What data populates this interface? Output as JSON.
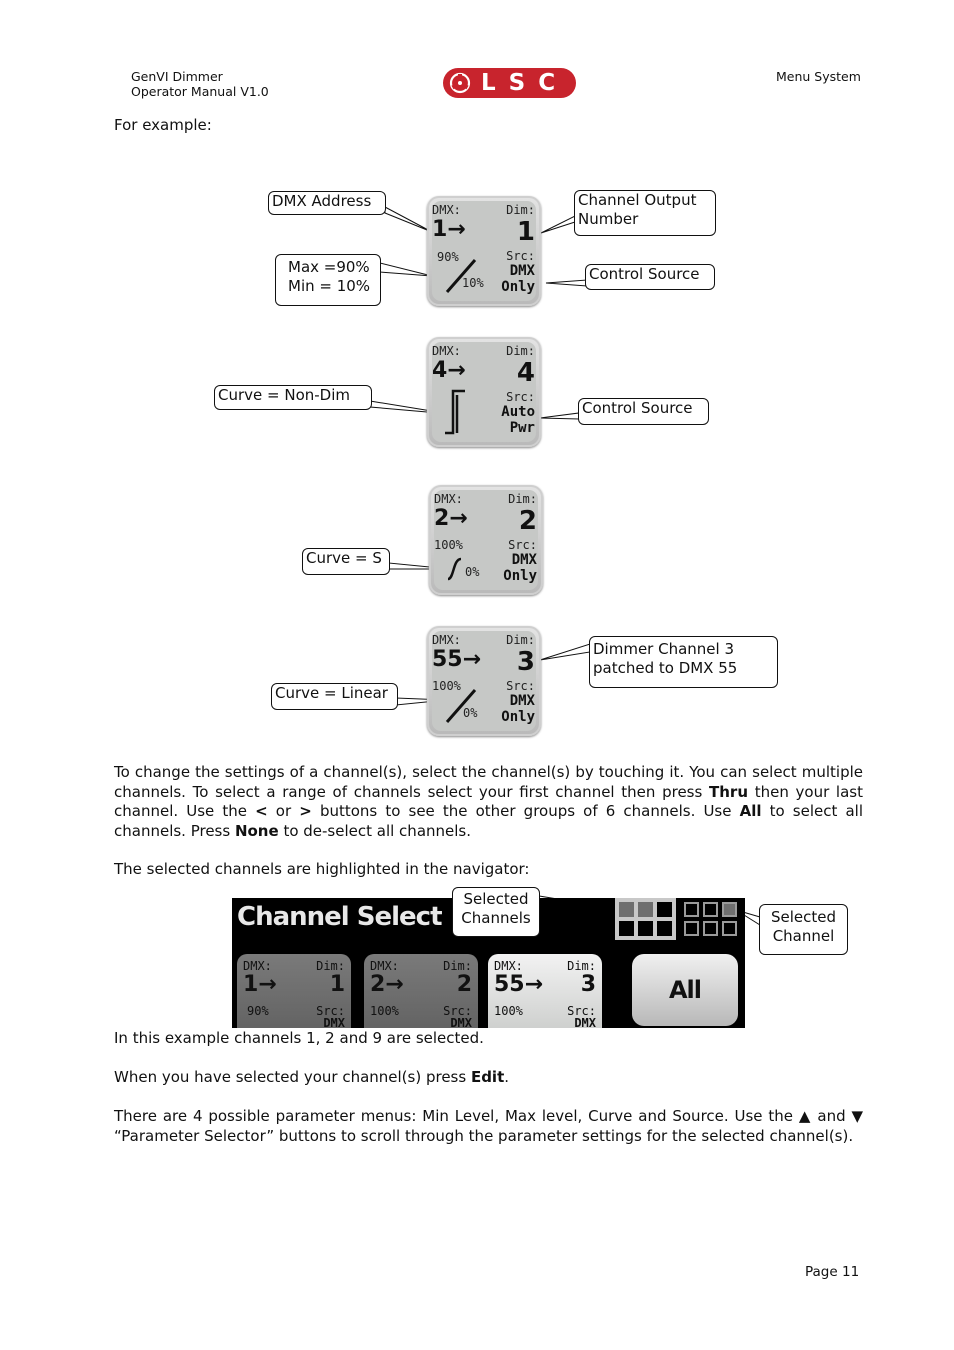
{
  "header": {
    "left_line1": "GenVI Dimmer",
    "left_line2": "Operator Manual V1.0",
    "logo_text": "LSC",
    "right": "Menu System"
  },
  "intro": "For example:",
  "tiles": [
    {
      "dmx_label": "DMX:",
      "dim_label": "Dim:",
      "dmx_value": "1→",
      "dim_value": "1",
      "max": "90%",
      "min": "10%",
      "curve": "linear",
      "src_label": "Src:",
      "src_line1": "DMX",
      "src_line2": "Only",
      "callouts": {
        "dmx": "DMX Address",
        "dim": "Channel Output Number",
        "range_line1": "Max =90%",
        "range_line2": "Min = 10%",
        "source": "Control Source"
      }
    },
    {
      "dmx_label": "DMX:",
      "dim_label": "Dim:",
      "dmx_value": "4→",
      "dim_value": "4",
      "curve": "non-dim",
      "src_label": "Src:",
      "src_line1": "Auto",
      "src_line2": "Pwr",
      "callouts": {
        "curve": "Curve = Non-Dim",
        "source": "Control Source"
      }
    },
    {
      "dmx_label": "DMX:",
      "dim_label": "Dim:",
      "dmx_value": "2→",
      "dim_value": "2",
      "max": "100%",
      "min": "0%",
      "curve": "s",
      "src_label": "Src:",
      "src_line1": "DMX",
      "src_line2": "Only",
      "callouts": {
        "curve": "Curve = S"
      }
    },
    {
      "dmx_label": "DMX:",
      "dim_label": "Dim:",
      "dmx_value": "55→",
      "dim_value": "3",
      "max": "100%",
      "min": "0%",
      "curve": "linear",
      "src_label": "Src:",
      "src_line1": "DMX",
      "src_line2": "Only",
      "callouts": {
        "curve": "Curve = Linear",
        "patch_line1": "Dimmer Channel 3",
        "patch_line2": "patched to DMX 55"
      }
    }
  ],
  "para1": {
    "t1": "To change the settings of a channel(s), select the channel(s) by touching it. You can select multiple channels. To select a range of channels select your first channel then press ",
    "b1": "Thru",
    "t2": " then your last channel. Use the ",
    "b2": "<",
    "t3": " or ",
    "b3": ">",
    "t4": " buttons to see the other groups of 6 channels. Use ",
    "b4": "All",
    "t5": " to select all channels. Press ",
    "b5": "None",
    "t6": " to de-select all channels."
  },
  "para2": "The selected channels are highlighted in the navigator:",
  "navigator": {
    "title": "Channel Select",
    "callout_selected_channels_1": "Selected",
    "callout_selected_channels_2": "Channels",
    "callout_selected_channel_1": "Selected",
    "callout_selected_channel_2": "Channel",
    "group1_selected": [
      true,
      true,
      false,
      false,
      false,
      false
    ],
    "group2_selected": [
      false,
      false,
      true,
      false,
      false,
      false
    ],
    "all_button": "All",
    "tiles": [
      {
        "dmx_label": "DMX:",
        "dim_label": "Dim:",
        "dmx_value": "1→",
        "dim_value": "1",
        "max": "90%",
        "src_label": "Src:",
        "src_line1": "DMX",
        "selected": true
      },
      {
        "dmx_label": "DMX:",
        "dim_label": "Dim:",
        "dmx_value": "2→",
        "dim_value": "2",
        "max": "100%",
        "src_label": "Src:",
        "src_line1": "DMX",
        "selected": true
      },
      {
        "dmx_label": "DMX:",
        "dim_label": "Dim:",
        "dmx_value": "55→",
        "dim_value": "3",
        "max": "100%",
        "src_label": "Src:",
        "src_line1": "DMX",
        "selected": false
      }
    ]
  },
  "para3": "In this example channels 1, 2 and 9 are selected.",
  "para4": {
    "t1": "When you have selected your channel(s) press ",
    "b1": "Edit",
    "t2": "."
  },
  "para5": "There are 4 possible parameter menus: Min Level, Max level, Curve and Source. Use the ▲ and ▼ “Parameter Selector” buttons to scroll through the parameter settings for the selected channel(s).",
  "footer": {
    "page": "Page 11"
  },
  "colors": {
    "logo_red": "#c8242d",
    "tile_grey": "#c6c8c6",
    "selected_tile": "#6e6e6e"
  }
}
